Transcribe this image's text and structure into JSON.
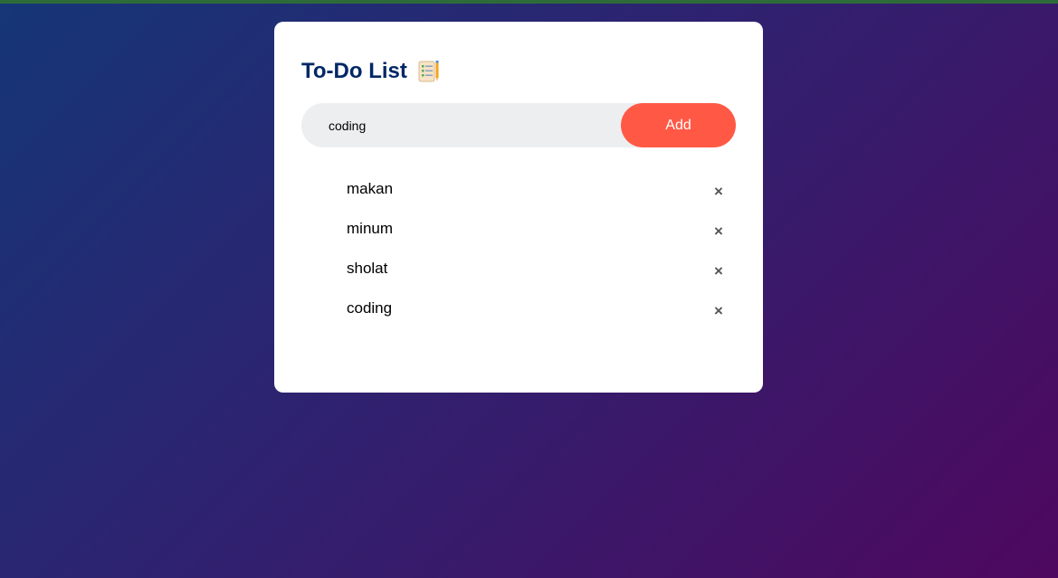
{
  "app": {
    "title": "To-Do List",
    "title_icon": "notepad-checklist-icon"
  },
  "input": {
    "value": "coding",
    "placeholder": ""
  },
  "add_button": {
    "label": "Add"
  },
  "tasks": [
    {
      "label": "makan",
      "remove_icon": "×"
    },
    {
      "label": "minum",
      "remove_icon": "×"
    },
    {
      "label": "sholat",
      "remove_icon": "×"
    },
    {
      "label": "coding",
      "remove_icon": "×"
    }
  ],
  "colors": {
    "title": "#002765",
    "accent_button": "#ff5945",
    "input_background": "#edeef0",
    "background_gradient_start": "#153677",
    "background_gradient_end": "#4e085f"
  }
}
